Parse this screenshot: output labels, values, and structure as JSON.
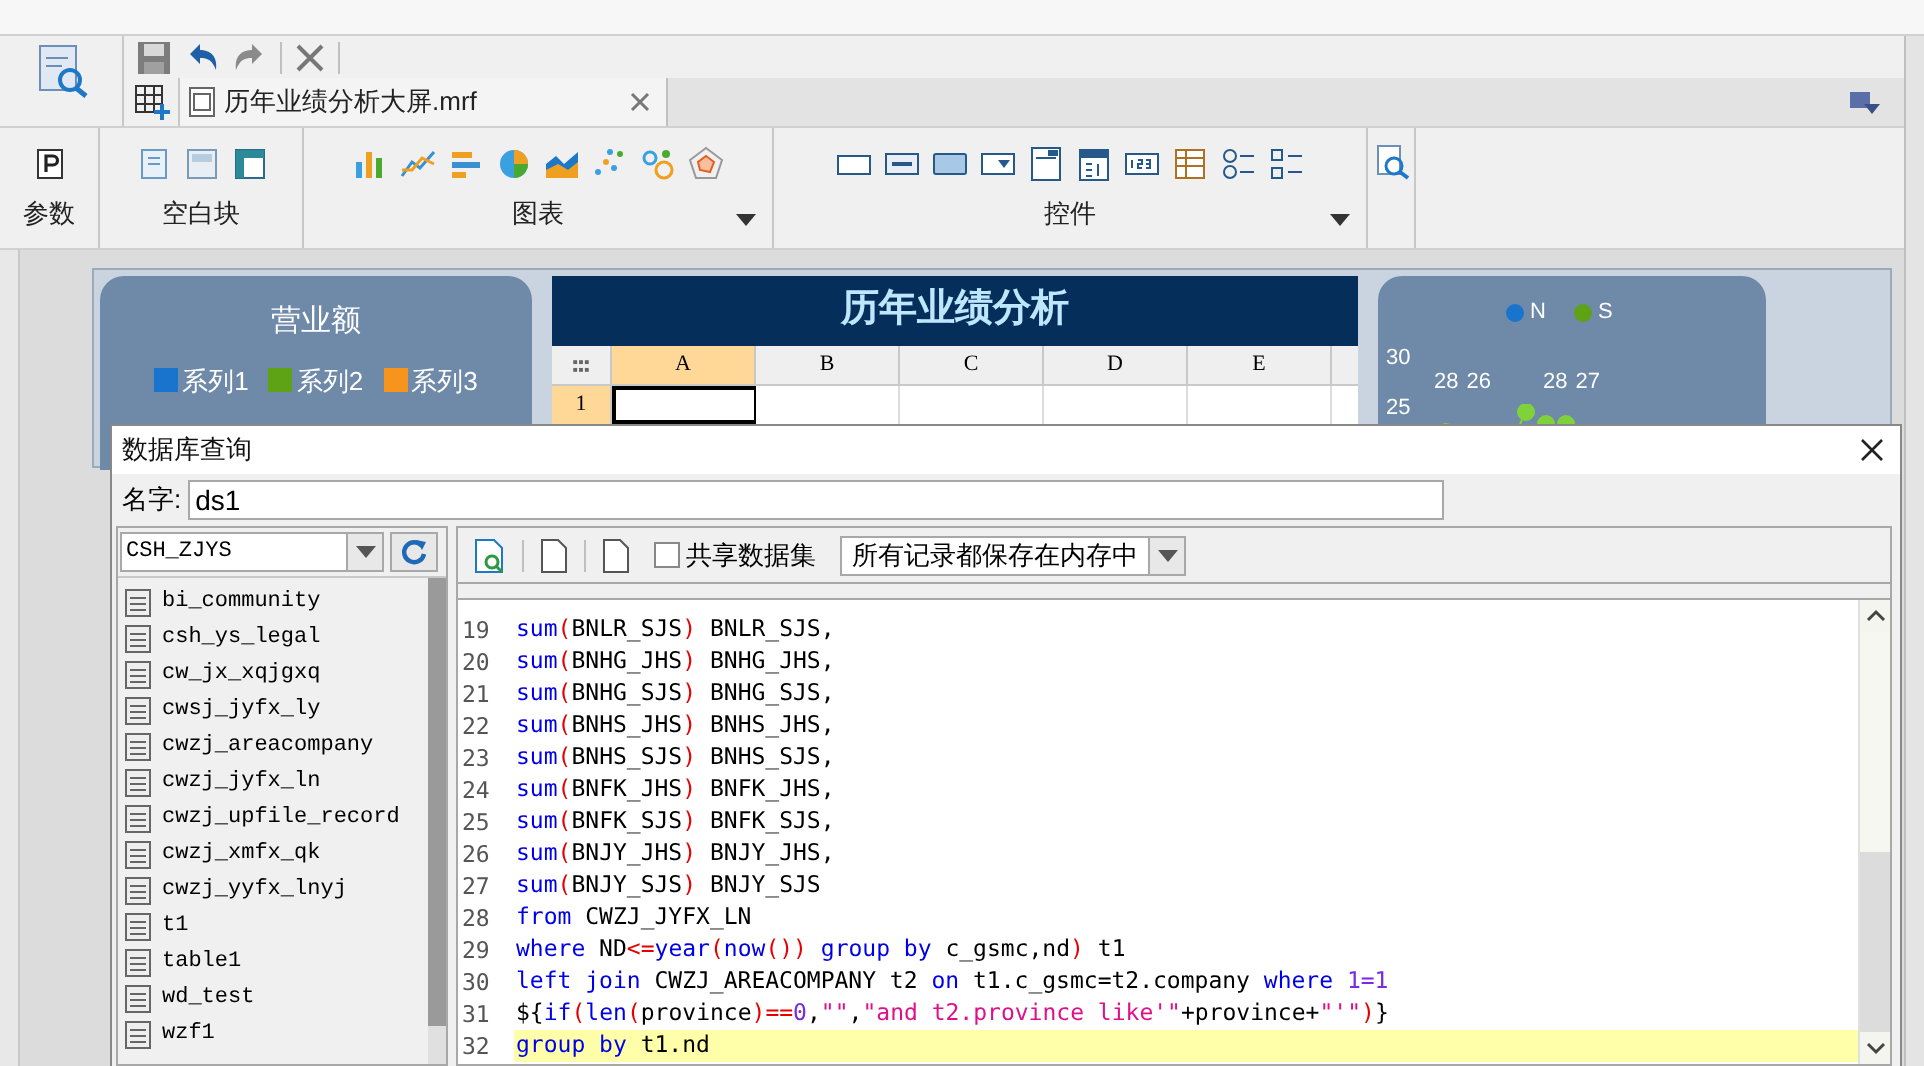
{
  "document_tab": {
    "label": "历年业绩分析大屏.mrf",
    "selected": true
  },
  "ribbon_groups": [
    {
      "kind": "params",
      "label": "参数",
      "menu": false
    },
    {
      "kind": "blank",
      "label": "空白块",
      "menu": false
    },
    {
      "kind": "chart",
      "label": "图表",
      "menu": true
    },
    {
      "kind": "widget",
      "label": "控件",
      "menu": true
    }
  ],
  "canvas": {
    "left_card": {
      "title": "营业额",
      "legend": [
        {
          "label": "系列1",
          "color": "#1874cd"
        },
        {
          "label": "系列2",
          "color": "#5ea215"
        },
        {
          "label": "系列3",
          "color": "#f7941d"
        }
      ]
    },
    "banner": "历年业绩分析",
    "sheet": {
      "columns": [
        {
          "label": "A",
          "selected": true
        },
        {
          "label": "B",
          "selected": false
        },
        {
          "label": "C",
          "selected": false
        },
        {
          "label": "D",
          "selected": false
        },
        {
          "label": "E",
          "selected": false
        }
      ],
      "rows": [
        "1"
      ]
    },
    "right_card": {
      "legend": [
        {
          "label": "N",
          "color": "#1874cd"
        },
        {
          "label": "S",
          "color": "#5ea215"
        }
      ],
      "axis_labels": [
        "30",
        "25"
      ],
      "point_labels": [
        "28",
        "26",
        "28",
        "27"
      ]
    }
  },
  "dialog": {
    "title": "数据库查询",
    "name_label": "名字:",
    "name_value": "ds1",
    "database": "CSH_ZJYS",
    "tables": [
      "bi_community",
      "csh_ys_legal",
      "cw_jx_xqjgxq",
      "cwsj_jyfx_ly",
      "cwzj_areacompany",
      "cwzj_jyfx_ln",
      "cwzj_upfile_record",
      "cwzj_xmfx_qk",
      "cwzj_yyfx_lnyj",
      "t1",
      "table1",
      "wd_test",
      "wzf1"
    ],
    "share_checkbox": {
      "label": "共享数据集",
      "checked": false
    },
    "storage_select": "所有记录都保存在内存中",
    "code_lines": [
      {
        "number": "19",
        "highlighted": false,
        "tokens": [
          {
            "kind": "kw",
            "text": "sum"
          },
          {
            "kind": "op",
            "text": "("
          },
          {
            "kind": "id",
            "text": "BNLR_SJS"
          },
          {
            "kind": "op",
            "text": ")"
          },
          {
            "kind": "id",
            "text": " BNLR_SJS,"
          }
        ]
      },
      {
        "number": "20",
        "highlighted": false,
        "tokens": [
          {
            "kind": "kw",
            "text": "sum"
          },
          {
            "kind": "op",
            "text": "("
          },
          {
            "kind": "id",
            "text": "BNHG_JHS"
          },
          {
            "kind": "op",
            "text": ")"
          },
          {
            "kind": "id",
            "text": " BNHG_JHS,"
          }
        ]
      },
      {
        "number": "21",
        "highlighted": false,
        "tokens": [
          {
            "kind": "kw",
            "text": "sum"
          },
          {
            "kind": "op",
            "text": "("
          },
          {
            "kind": "id",
            "text": "BNHG_SJS"
          },
          {
            "kind": "op",
            "text": ")"
          },
          {
            "kind": "id",
            "text": " BNHG_SJS,"
          }
        ]
      },
      {
        "number": "22",
        "highlighted": false,
        "tokens": [
          {
            "kind": "kw",
            "text": "sum"
          },
          {
            "kind": "op",
            "text": "("
          },
          {
            "kind": "id",
            "text": "BNHS_JHS"
          },
          {
            "kind": "op",
            "text": ")"
          },
          {
            "kind": "id",
            "text": " BNHS_JHS,"
          }
        ]
      },
      {
        "number": "23",
        "highlighted": false,
        "tokens": [
          {
            "kind": "kw",
            "text": "sum"
          },
          {
            "kind": "op",
            "text": "("
          },
          {
            "kind": "id",
            "text": "BNHS_SJS"
          },
          {
            "kind": "op",
            "text": ")"
          },
          {
            "kind": "id",
            "text": " BNHS_SJS,"
          }
        ]
      },
      {
        "number": "24",
        "highlighted": false,
        "tokens": [
          {
            "kind": "kw",
            "text": "sum"
          },
          {
            "kind": "op",
            "text": "("
          },
          {
            "kind": "id",
            "text": "BNFK_JHS"
          },
          {
            "kind": "op",
            "text": ")"
          },
          {
            "kind": "id",
            "text": " BNFK_JHS,"
          }
        ]
      },
      {
        "number": "25",
        "highlighted": false,
        "tokens": [
          {
            "kind": "kw",
            "text": "sum"
          },
          {
            "kind": "op",
            "text": "("
          },
          {
            "kind": "id",
            "text": "BNFK_SJS"
          },
          {
            "kind": "op",
            "text": ")"
          },
          {
            "kind": "id",
            "text": " BNFK_SJS,"
          }
        ]
      },
      {
        "number": "26",
        "highlighted": false,
        "tokens": [
          {
            "kind": "kw",
            "text": "sum"
          },
          {
            "kind": "op",
            "text": "("
          },
          {
            "kind": "id",
            "text": "BNJY_JHS"
          },
          {
            "kind": "op",
            "text": ")"
          },
          {
            "kind": "id",
            "text": " BNJY_JHS,"
          }
        ]
      },
      {
        "number": "27",
        "highlighted": false,
        "tokens": [
          {
            "kind": "kw",
            "text": "sum"
          },
          {
            "kind": "op",
            "text": "("
          },
          {
            "kind": "id",
            "text": "BNJY_SJS"
          },
          {
            "kind": "op",
            "text": ")"
          },
          {
            "kind": "id",
            "text": " BNJY_SJS"
          }
        ]
      },
      {
        "number": "28",
        "highlighted": false,
        "tokens": [
          {
            "kind": "kw",
            "text": "from"
          },
          {
            "kind": "id",
            "text": " CWZJ_JYFX_LN"
          }
        ]
      },
      {
        "number": "29",
        "highlighted": false,
        "tokens": [
          {
            "kind": "kw",
            "text": "where"
          },
          {
            "kind": "id",
            "text": " ND"
          },
          {
            "kind": "op",
            "text": "<="
          },
          {
            "kind": "kw",
            "text": "year"
          },
          {
            "kind": "op",
            "text": "("
          },
          {
            "kind": "kw",
            "text": "now"
          },
          {
            "kind": "op",
            "text": "()) "
          },
          {
            "kind": "kw",
            "text": "group by"
          },
          {
            "kind": "id",
            "text": " c_gsmc,nd"
          },
          {
            "kind": "op",
            "text": ")"
          },
          {
            "kind": "id",
            "text": " t1"
          }
        ]
      },
      {
        "number": "30",
        "highlighted": false,
        "tokens": [
          {
            "kind": "kw",
            "text": "left join"
          },
          {
            "kind": "id",
            "text": " CWZJ_AREACOMPANY t2 "
          },
          {
            "kind": "kw",
            "text": "on"
          },
          {
            "kind": "id",
            "text": " t1.c_gsmc=t2.company "
          },
          {
            "kind": "kw",
            "text": "where"
          },
          {
            "kind": "num",
            "text": " 1=1"
          }
        ]
      },
      {
        "number": "31",
        "highlighted": false,
        "tokens": [
          {
            "kind": "id",
            "text": "${"
          },
          {
            "kind": "kw",
            "text": "if"
          },
          {
            "kind": "op",
            "text": "("
          },
          {
            "kind": "kw",
            "text": "len"
          },
          {
            "kind": "op",
            "text": "("
          },
          {
            "kind": "id",
            "text": "province"
          },
          {
            "kind": "op",
            "text": ")=="
          },
          {
            "kind": "num",
            "text": "0"
          },
          {
            "kind": "id",
            "text": ","
          },
          {
            "kind": "str",
            "text": "\"\""
          },
          {
            "kind": "id",
            "text": ","
          },
          {
            "kind": "str",
            "text": "\"and t2.province like'\""
          },
          {
            "kind": "id",
            "text": "+province+"
          },
          {
            "kind": "str",
            "text": "\"'\""
          },
          {
            "kind": "op",
            "text": ")"
          },
          {
            "kind": "id",
            "text": "}"
          }
        ]
      },
      {
        "number": "32",
        "highlighted": true,
        "tokens": [
          {
            "kind": "kw",
            "text": "group by"
          },
          {
            "kind": "id",
            "text": " t1.nd"
          }
        ]
      }
    ]
  }
}
